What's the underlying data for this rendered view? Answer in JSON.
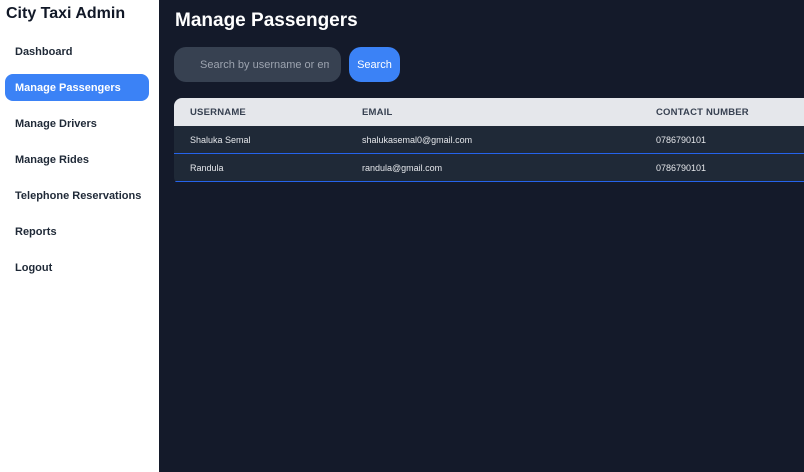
{
  "sidebar": {
    "brand": "City Taxi Admin",
    "items": [
      {
        "label": "Dashboard"
      },
      {
        "label": "Manage Passengers",
        "active": true
      },
      {
        "label": "Manage Drivers"
      },
      {
        "label": "Manage Rides"
      },
      {
        "label": "Telephone Reservations"
      },
      {
        "label": "Reports"
      },
      {
        "label": "Logout"
      }
    ]
  },
  "main": {
    "title": "Manage Passengers",
    "search": {
      "placeholder": "Search by username or email",
      "value": "",
      "button_label": "Search"
    },
    "table": {
      "columns": [
        "USERNAME",
        "EMAIL",
        "CONTACT NUMBER"
      ],
      "rows": [
        [
          "Shaluka Semal",
          "shalukasemal0@gmail.com",
          "0786790101"
        ],
        [
          "Randula",
          "randula@gmail.com",
          "0786790101"
        ]
      ]
    }
  },
  "colors": {
    "accent": "#3b82f6",
    "background": "#141a2a",
    "sidebar": "#ffffff",
    "row_background": "#1f2937",
    "header_background": "#e5e7eb"
  }
}
